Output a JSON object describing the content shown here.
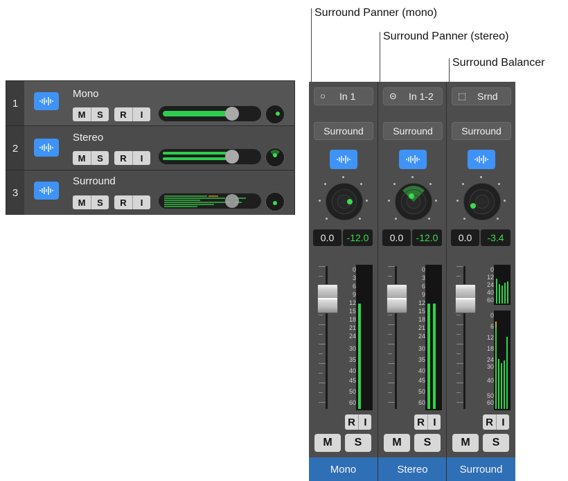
{
  "callouts": {
    "surround_panner_mono": "Surround Panner (mono)",
    "surround_panner_stereo": "Surround Panner (stereo)",
    "surround_balancer": "Surround Balancer"
  },
  "tracks": [
    {
      "number": "1",
      "name": "Mono",
      "mute": "M",
      "solo": "S",
      "record": "R",
      "input": "I",
      "volume_level": 0.72
    },
    {
      "number": "2",
      "name": "Stereo",
      "mute": "M",
      "solo": "S",
      "record": "R",
      "input": "I",
      "volume_level": 0.72
    },
    {
      "number": "3",
      "name": "Surround",
      "mute": "M",
      "solo": "S",
      "record": "R",
      "input": "I",
      "volume_level": 0.72
    }
  ],
  "channel_strips": [
    {
      "input_icon": "○",
      "input_label": "In 1",
      "output_label": "Surround",
      "pan_value": "0.0",
      "gain_value": "-12.0",
      "record": "R",
      "input": "I",
      "mute": "M",
      "solo": "S",
      "name": "Mono"
    },
    {
      "input_icon": "⊝",
      "input_label": "In 1-2",
      "output_label": "Surround",
      "pan_value": "0.0",
      "gain_value": "-12.0",
      "record": "R",
      "input": "I",
      "mute": "M",
      "solo": "S",
      "name": "Stereo"
    },
    {
      "input_icon": "⬚",
      "input_label": "Srnd",
      "output_label": "Surround",
      "pan_value": "0.0",
      "gain_value": "-3.4",
      "record": "R",
      "input": "I",
      "mute": "M",
      "solo": "S",
      "name": "Surround"
    }
  ],
  "meter_scale": [
    "0",
    "3",
    "6",
    "9",
    "12",
    "15",
    "18",
    "21",
    "24",
    "30",
    "35",
    "40",
    "45",
    "50",
    "60"
  ],
  "balancer_scale_top": [
    "0",
    "12",
    "24",
    "40",
    "60"
  ],
  "balancer_scale_bottom": [
    "0",
    "6",
    "12",
    "18",
    "24",
    "30",
    "40",
    "50",
    "60"
  ],
  "colors": {
    "accent_blue": "#3f93f6",
    "meter_green": "#2ecc4f",
    "name_bar": "#2f6fb6",
    "strip_bg": "#4d4d4d"
  }
}
